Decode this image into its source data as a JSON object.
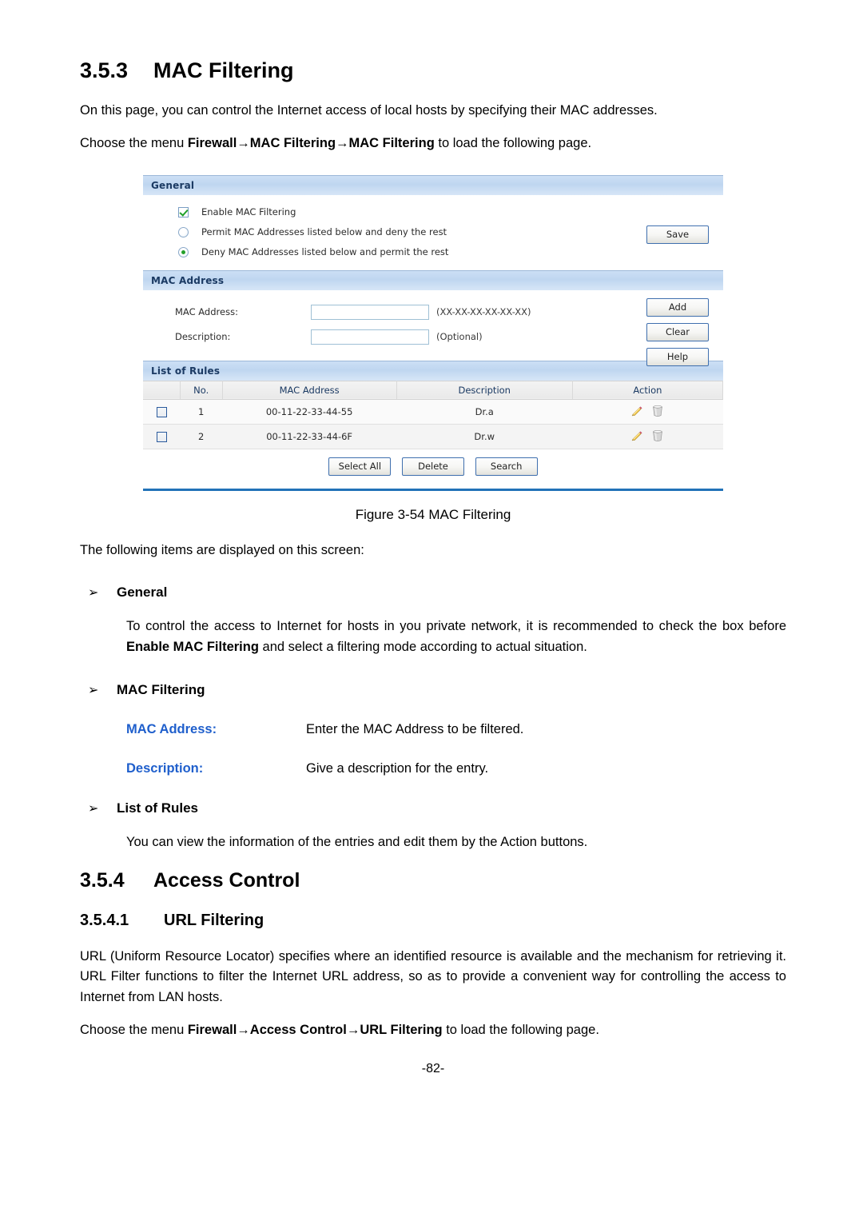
{
  "document": {
    "section_number": "3.5.3",
    "section_title": "MAC Filtering",
    "intro_paragraph": "On this page, you can control the Internet access of local hosts by specifying their MAC addresses.",
    "choose_menu_prefix": "Choose the menu ",
    "choose_menu_path": "Firewall→MAC Filtering→MAC Filtering",
    "choose_menu_suffix": " to load the following page.",
    "figure_caption": "Figure 3-54 MAC Filtering",
    "following_items": "The following items are displayed on this screen:",
    "bullet_marker": "➢",
    "bullet_general": "General",
    "general_paragraph_part1": "To control the access to Internet for hosts in you private network, it is recommended to check the box before ",
    "general_paragraph_bold": "Enable MAC Filtering",
    "general_paragraph_part2": " and select a filtering mode according to actual situation.",
    "bullet_mac_filtering": "MAC Filtering",
    "definitions": [
      {
        "term": "MAC Address:",
        "desc": "Enter the MAC Address to be filtered."
      },
      {
        "term": "Description:",
        "desc": "Give a description for the entry."
      }
    ],
    "bullet_list_of_rules": "List of Rules",
    "list_of_rules_paragraph": "You can view the information of the entries and edit them by the Action buttons.",
    "section2_number": "3.5.4",
    "section2_title": "Access Control",
    "subsection_number": "3.5.4.1",
    "subsection_title": "URL Filtering",
    "url_paragraph": "URL (Uniform Resource Locator) specifies where an identified resource is available and the mechanism for retrieving it. URL Filter functions to filter the Internet URL address, so as to provide a convenient way for controlling the access to Internet from LAN hosts.",
    "choose_menu2_prefix": "Choose the menu ",
    "choose_menu2_path": "Firewall→Access Control→URL Filtering",
    "choose_menu2_suffix": " to load the following page.",
    "page_footer": "-82-"
  },
  "ui": {
    "general": {
      "header": "General",
      "enable_checkbox_label": "Enable MAC Filtering",
      "enable_checked": true,
      "permit_radio_label": "Permit MAC Addresses listed below and deny the rest",
      "permit_selected": false,
      "deny_radio_label": "Deny MAC Addresses listed below and permit the rest",
      "deny_selected": true,
      "save_button": "Save"
    },
    "mac_address": {
      "header": "MAC Address",
      "mac_label": "MAC Address:",
      "mac_value": "",
      "mac_hint": "(XX-XX-XX-XX-XX-XX)",
      "desc_label": "Description:",
      "desc_value": "",
      "desc_hint": "(Optional)",
      "add_button": "Add",
      "clear_button": "Clear",
      "help_button": "Help"
    },
    "list_of_rules": {
      "header": "List of Rules",
      "columns": [
        "",
        "No.",
        "MAC Address",
        "Description",
        "Action"
      ],
      "rows": [
        {
          "checked": false,
          "no": "1",
          "mac": "00-11-22-33-44-55",
          "description": "Dr.a"
        },
        {
          "checked": false,
          "no": "2",
          "mac": "00-11-22-33-44-6F",
          "description": "Dr.w"
        }
      ],
      "select_all_button": "Select All",
      "delete_button": "Delete",
      "search_button": "Search"
    },
    "colors": {
      "panel_header_text": "#1b3a63",
      "panel_header_bg": "#c6daf2",
      "button_border": "#3f6fae",
      "accent_rule": "#2272b8",
      "definition_term": "#1F5FCC",
      "check_green": "#22a12a"
    }
  }
}
